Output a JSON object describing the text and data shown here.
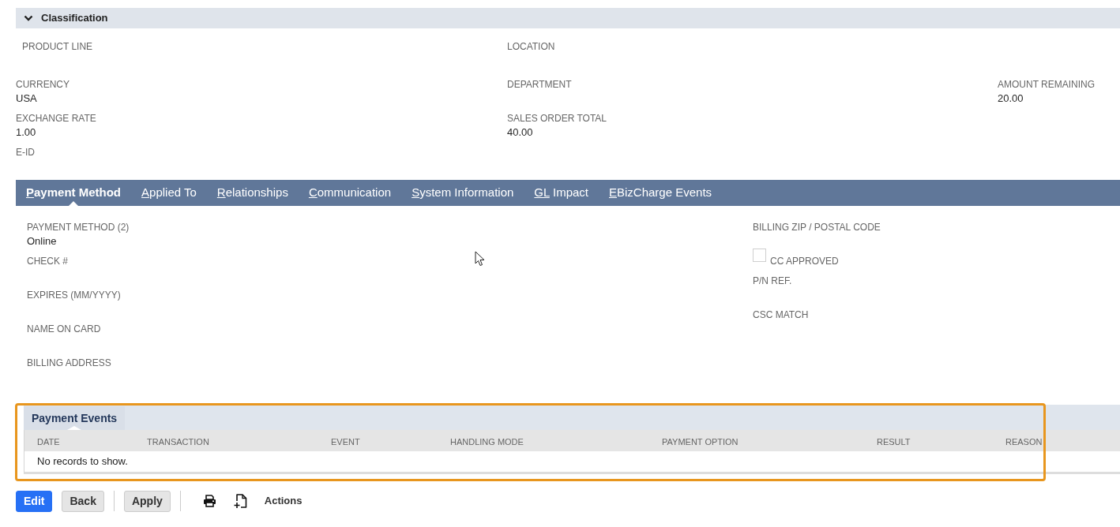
{
  "classification": {
    "title": "Classification",
    "expanded": true,
    "rows": [
      [
        {
          "label": "PRODUCT LINE"
        },
        {
          "label": "LOCATION"
        }
      ],
      [
        {
          "label": "CURRENCY",
          "value": "USA"
        },
        {
          "label": "DEPARTMENT"
        },
        {
          "label": "AMOUNT REMAINING",
          "value": "20.00"
        }
      ],
      [
        {
          "label": "EXCHANGE RATE",
          "value": "1.00"
        },
        {
          "label": "SALES ORDER TOTAL",
          "value": "40.00"
        }
      ],
      [
        {
          "label": "E-ID"
        }
      ]
    ]
  },
  "tabs": [
    {
      "hotkey": "P",
      "rest": "ayment Method",
      "selected": true
    },
    {
      "hotkey": "A",
      "rest": "pplied To",
      "selected": false
    },
    {
      "hotkey": "R",
      "rest": "elationships",
      "selected": false
    },
    {
      "hotkey": "C",
      "rest": "ommunication",
      "selected": false
    },
    {
      "hotkey": "S",
      "rest": "ystem Information",
      "selected": false
    },
    {
      "hotkey": "GL",
      "rest": " Impact",
      "selected": false
    },
    {
      "hotkey": "E",
      "rest": "BizCharge Events",
      "selected": false
    }
  ],
  "payment_method": {
    "columns": [
      [
        {
          "kind": "field",
          "label": "PAYMENT METHOD (2)",
          "value": "Online"
        },
        {
          "kind": "field",
          "label": "CHECK #"
        },
        {
          "kind": "field",
          "label": "EXPIRES (MM/YYYY)"
        },
        {
          "kind": "field",
          "label": "NAME ON CARD"
        },
        {
          "kind": "field",
          "label": "BILLING ADDRESS"
        }
      ],
      [
        {
          "kind": "field",
          "label": "BILLING ZIP / POSTAL CODE"
        },
        {
          "kind": "checkbox",
          "label": "CC APPROVED",
          "checked": false
        },
        {
          "kind": "field",
          "label": "P/N REF."
        },
        {
          "kind": "field",
          "label": "CSC MATCH"
        }
      ]
    ]
  },
  "payment_events": {
    "highlighted": true,
    "tab": {
      "label": "Payment Events",
      "selected": true
    },
    "columns": [
      "DATE",
      "TRANSACTION",
      "EVENT",
      "HANDLING MODE",
      "PAYMENT OPTION",
      "RESULT",
      "REASON"
    ],
    "empty_message": "No records to show."
  },
  "toolbar": {
    "button_groups": [
      [
        {
          "label": "Edit",
          "kind": "primary"
        },
        {
          "label": "Back",
          "kind": "secondary"
        }
      ],
      [
        {
          "label": "Apply",
          "kind": "secondary"
        }
      ]
    ],
    "actions": {
      "label": "Actions"
    }
  }
}
